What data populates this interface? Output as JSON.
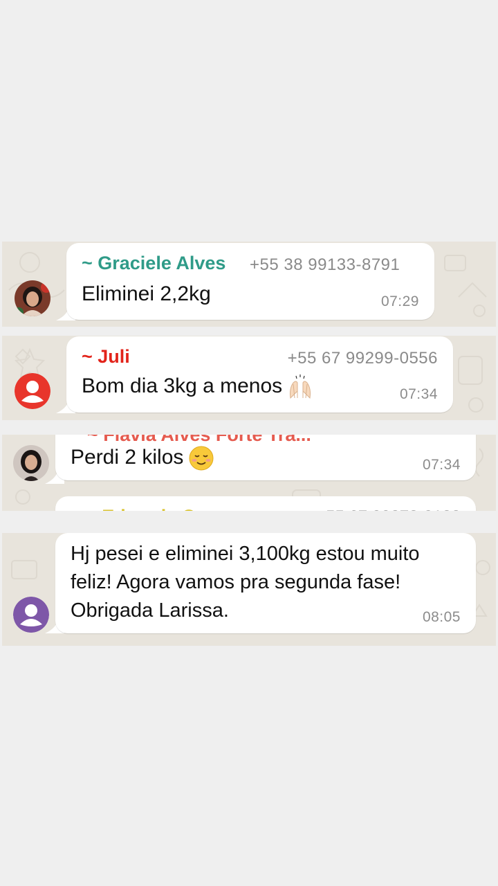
{
  "colors": {
    "chat_background": "#e8e4dc",
    "page_background": "#efefef",
    "bubble": "#ffffff",
    "sender_graciele": "#2f9b88",
    "sender_juli": "#e2231a",
    "sender_flavia": "#e55b4f",
    "sender_eduarda": "#d9c22a",
    "avatar_juli": "#e8352b",
    "avatar_purple": "#7e57a8"
  },
  "messages": [
    {
      "sender": "~ Graciele Alves",
      "phone": "+55 38 99133-8791",
      "text": "Eliminei 2,2kg",
      "time": "07:29",
      "avatar_icon": "profile-photo-icon"
    },
    {
      "sender": "~ Juli",
      "phone": "+55 67 99299-0556",
      "text": "Bom dia 3kg a menos",
      "emoji": "raising-hands-emoji",
      "time": "07:34",
      "avatar_icon": "default-user-icon"
    },
    {
      "text": "Perdi 2 kilos",
      "emoji": "smiling-face-emoji",
      "time": "07:34",
      "avatar_icon": "profile-photo-icon"
    },
    {
      "lines": [
        "Hj pesei e eliminei 3,100kg estou muito",
        "feliz! Agora vamos pra segunda fase!",
        "Obrigada Larissa."
      ],
      "time": "08:05",
      "avatar_icon": "default-user-icon"
    }
  ]
}
